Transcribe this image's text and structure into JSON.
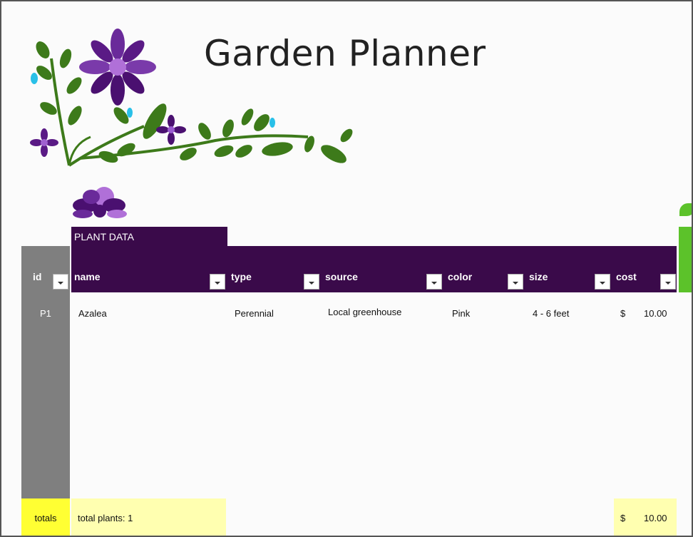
{
  "title": "Garden Planner",
  "section_tab": "PLANT DATA",
  "columns": [
    {
      "key": "id",
      "label": "id"
    },
    {
      "key": "name",
      "label": "name"
    },
    {
      "key": "type",
      "label": "type"
    },
    {
      "key": "source",
      "label": "source"
    },
    {
      "key": "color",
      "label": "color"
    },
    {
      "key": "size",
      "label": "size"
    },
    {
      "key": "cost",
      "label": "cost"
    }
  ],
  "rows": [
    {
      "id": "P1",
      "name": "Azalea",
      "type": "Perennial",
      "source": "Local greenhouse",
      "color": "Pink",
      "size": "4 - 6 feet",
      "cost_symbol": "$",
      "cost_value": "10.00"
    }
  ],
  "totals": {
    "label": "totals",
    "plants": "total plants: 1",
    "cost_symbol": "$",
    "cost_value": "10.00"
  },
  "colors": {
    "header": "#3a0a4a",
    "id_column": "#7f7f7f",
    "totals_label": "#ffff33",
    "totals_cells": "#ffffb0",
    "accent_green": "#5cc22a",
    "flower_purple": "#6a2a9a"
  },
  "icons": [
    "flower-vine-decoration",
    "flower-cluster-icon",
    "filter-dropdown-icon"
  ]
}
